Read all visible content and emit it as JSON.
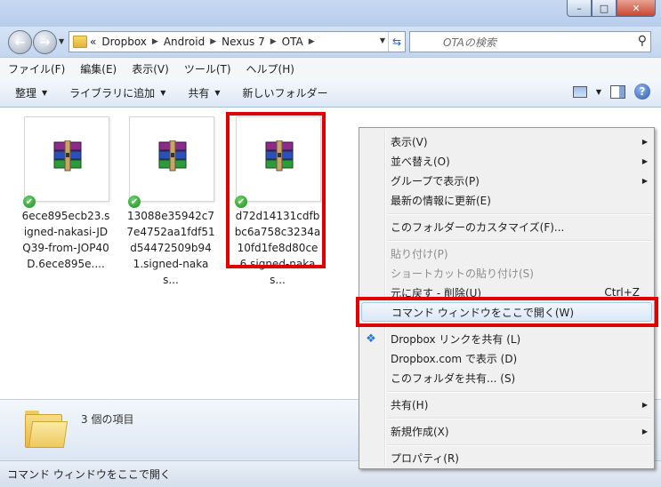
{
  "window": {
    "min_label": "–",
    "max_label": "□",
    "close_label": "✕"
  },
  "nav": {
    "back": "←",
    "forward": "→",
    "breadcrumb_prefix": "«",
    "breadcrumbs": [
      "Dropbox",
      "Android",
      "Nexus 7",
      "OTA"
    ],
    "search_placeholder": "OTAの検索"
  },
  "menubar": [
    "ファイル(F)",
    "編集(E)",
    "表示(V)",
    "ツール(T)",
    "ヘルプ(H)"
  ],
  "commandbar": [
    "整理",
    "ライブラリに追加",
    "共有",
    "新しいフォルダー"
  ],
  "files": [
    {
      "name": "6ece895ecb23.signed-nakasi-JDQ39-from-JOP40D.6ece895e...."
    },
    {
      "name": "13088e35942c77e4752aa1fdf51d54472509b941.signed-nakas..."
    },
    {
      "name": "d72d14131cdfbbc6a758c3234a10fd1fe8d80ce6.signed-nakas..."
    }
  ],
  "details": {
    "count": "3 個の項目"
  },
  "status": "コマンド ウィンドウをここで開く",
  "context_menu": {
    "view": "表示(V)",
    "sort": "並べ替え(O)",
    "group": "グループで表示(P)",
    "refresh": "最新の情報に更新(E)",
    "customize": "このフォルダーのカスタマイズ(F)...",
    "paste": "貼り付け(P)",
    "paste_shortcut": "ショートカットの貼り付け(S)",
    "undo": "元に戻す - 削除(U)",
    "undo_shortcut": "Ctrl+Z",
    "open_cmd": "コマンド ウィンドウをここで開く(W)",
    "dropbox_share": "Dropbox リンクを共有 (L)",
    "dropbox_view": "Dropbox.com で表示 (D)",
    "share_folder": "このフォルダを共有... (S)",
    "share": "共有(H)",
    "new": "新規作成(X)",
    "properties": "プロパティ(R)"
  }
}
